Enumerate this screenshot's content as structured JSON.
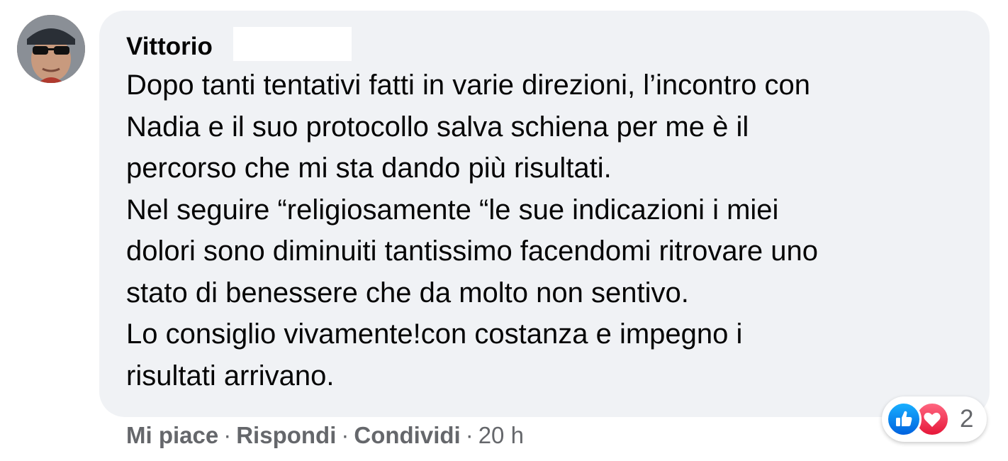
{
  "comment": {
    "author": "Vittorio",
    "lines": [
      "Dopo tanti tentativi fatti in varie direzioni, l’incontro con",
      "Nadia e il suo protocollo salva schiena per me è il",
      "percorso che mi sta dando più risultati.",
      "Nel seguire “religiosamente “le sue indicazioni i miei",
      "dolori sono diminuiti tantissimo facendomi ritrovare uno",
      "stato di benessere che da molto non sentivo.",
      "Lo consiglio vivamente!con costanza e impegno i",
      "risultati arrivano."
    ]
  },
  "actions": {
    "like_label": "Mi piace",
    "reply_label": "Rispondi",
    "share_label": "Condividi",
    "separator": "·",
    "timestamp": "20 h"
  },
  "reactions": {
    "icons": [
      "like-icon",
      "love-icon"
    ],
    "count": "2"
  },
  "colors": {
    "bubble_bg": "#f0f2f5",
    "text": "#050505",
    "secondary_text": "#65676b",
    "like_blue": "#1877f2",
    "love_red": "#f33e58"
  }
}
